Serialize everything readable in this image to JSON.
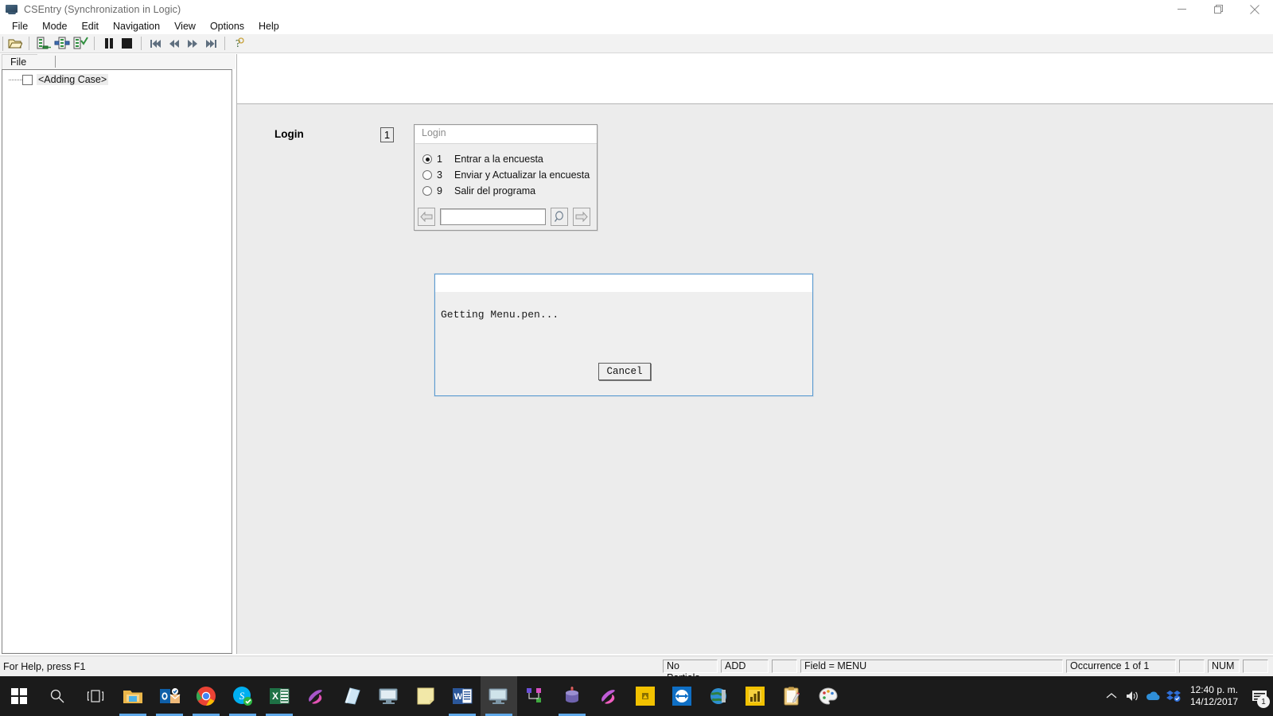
{
  "window": {
    "title": "CSEntry (Synchronization in Logic)",
    "icon": "monitor-icon",
    "controls": {
      "minimize": "minimize-icon",
      "maximize": "maximize-icon",
      "close": "close-icon"
    }
  },
  "menubar": {
    "items": [
      "File",
      "Mode",
      "Edit",
      "Navigation",
      "View",
      "Options",
      "Help"
    ]
  },
  "toolbar": {
    "buttons": [
      {
        "name": "open-icon",
        "title": "Open"
      },
      {
        "name": "add-case-icon",
        "title": "Add Case"
      },
      {
        "name": "modify-case-icon",
        "title": "Modify Case"
      },
      {
        "name": "verify-case-icon",
        "title": "Verify Case"
      },
      {
        "name": "pause-icon",
        "title": "Pause"
      },
      {
        "name": "stop-icon",
        "title": "Stop"
      },
      {
        "name": "first-icon",
        "title": "First"
      },
      {
        "name": "previous-icon",
        "title": "Previous"
      },
      {
        "name": "next-icon",
        "title": "Next"
      },
      {
        "name": "last-icon",
        "title": "Last"
      },
      {
        "name": "help-icon",
        "title": "Help"
      }
    ]
  },
  "left_panel": {
    "tab_label": "File",
    "tree": [
      {
        "label": "<Adding Case>",
        "checked": false
      }
    ]
  },
  "form": {
    "field_label": "Login",
    "field_value": "1"
  },
  "login_popup": {
    "title": "Login",
    "options": [
      {
        "code": "1",
        "label": "Entrar a la encuesta",
        "selected": true
      },
      {
        "code": "3",
        "label": "Enviar y Actualizar la encuesta",
        "selected": false
      },
      {
        "code": "9",
        "label": "Salir del programa",
        "selected": false
      }
    ],
    "input_value": "",
    "input_placeholder": "",
    "back_button": "back-arrow-icon",
    "search_button": "magnifier-icon",
    "forward_button": "forward-arrow-icon"
  },
  "dialog": {
    "title": "",
    "message": "Getting Menu.pen...",
    "cancel_label": "Cancel",
    "border_color": "#5b9bd1"
  },
  "statusbar": {
    "help_text": "For Help, press F1",
    "cells": [
      "No Partials",
      "ADD",
      "",
      "Field = MENU",
      "Occurrence 1 of 1",
      "",
      "NUM",
      ""
    ]
  },
  "taskbar": {
    "start": "windows-start-icon",
    "search": "search-icon",
    "task_view": "task-view-icon",
    "apps": [
      {
        "name": "file-explorer-icon",
        "running": true,
        "active": false
      },
      {
        "name": "outlook-icon",
        "running": true,
        "active": false
      },
      {
        "name": "chrome-icon",
        "running": true,
        "active": false
      },
      {
        "name": "skype-icon",
        "running": true,
        "active": false
      },
      {
        "name": "excel-icon",
        "running": true,
        "active": false
      },
      {
        "name": "sql-server-icon",
        "running": false,
        "active": false
      },
      {
        "name": "notepad-icon",
        "running": false,
        "active": false
      },
      {
        "name": "monitor-icon",
        "running": false,
        "active": false
      },
      {
        "name": "sticky-notes-icon",
        "running": false,
        "active": false
      },
      {
        "name": "word-icon",
        "running": true,
        "active": false
      },
      {
        "name": "csentry-icon",
        "running": true,
        "active": true
      },
      {
        "name": "network-map-icon",
        "running": false,
        "active": false
      },
      {
        "name": "database-icon",
        "running": true,
        "active": false
      },
      {
        "name": "sql-profiler-icon",
        "running": false,
        "active": false
      },
      {
        "name": "yellow-app-icon",
        "running": false,
        "active": false
      },
      {
        "name": "teamviewer-icon",
        "running": false,
        "active": false
      },
      {
        "name": "globe-icon",
        "running": false,
        "active": false
      },
      {
        "name": "powerbi-icon",
        "running": false,
        "active": false
      },
      {
        "name": "clipboard-icon",
        "running": false,
        "active": false
      },
      {
        "name": "paint-icon",
        "running": false,
        "active": false
      }
    ],
    "tray": {
      "chevron": "show-hidden-icons-icon",
      "volume": "volume-icon",
      "onedrive": "onedrive-icon",
      "dropbox": "dropbox-icon",
      "time": "12:40 p. m.",
      "date": "14/12/2017",
      "notifications_icon": "action-center-icon",
      "notifications_count": "1"
    }
  }
}
